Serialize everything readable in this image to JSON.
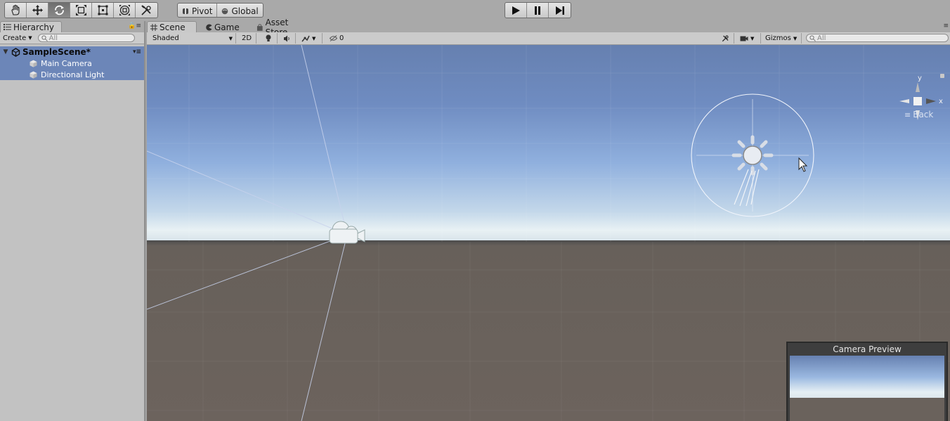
{
  "toolbar": {
    "transform_tools": [
      "hand-tool",
      "move-tool",
      "rotate-tool",
      "scale-tool",
      "rect-tool",
      "transform-tool",
      "custom-tool"
    ],
    "active_tool": "rotate-tool",
    "pivot_label": "Pivot",
    "global_label": "Global",
    "playback": [
      "play",
      "pause",
      "step"
    ]
  },
  "hierarchy": {
    "tab_label": "Hierarchy",
    "create_label": "Create",
    "search_placeholder": "All",
    "scene_name": "SampleScene*",
    "items": [
      {
        "label": "Main Camera"
      },
      {
        "label": "Directional Light"
      }
    ]
  },
  "scene_tabs": [
    {
      "label": "Scene",
      "icon": "grid-icon",
      "active": true
    },
    {
      "label": "Game",
      "icon": "pacman-icon",
      "active": false
    },
    {
      "label": "Asset Store",
      "icon": "bag-icon",
      "active": false
    }
  ],
  "scene_toolbar": {
    "shading_mode": "Shaded",
    "mode_2d": "2D",
    "hidden_count": "0",
    "gizmos_label": "Gizmos",
    "search_placeholder": "All"
  },
  "gizmo": {
    "y_label": "y",
    "x_label": "x",
    "view_label": "Back"
  },
  "camera_preview": {
    "title": "Camera Preview"
  },
  "colors": {
    "sky_top": "#6880b0",
    "horizon": "#e6f0f4",
    "ground": "#6b625c",
    "selection": "#6c86b8"
  }
}
